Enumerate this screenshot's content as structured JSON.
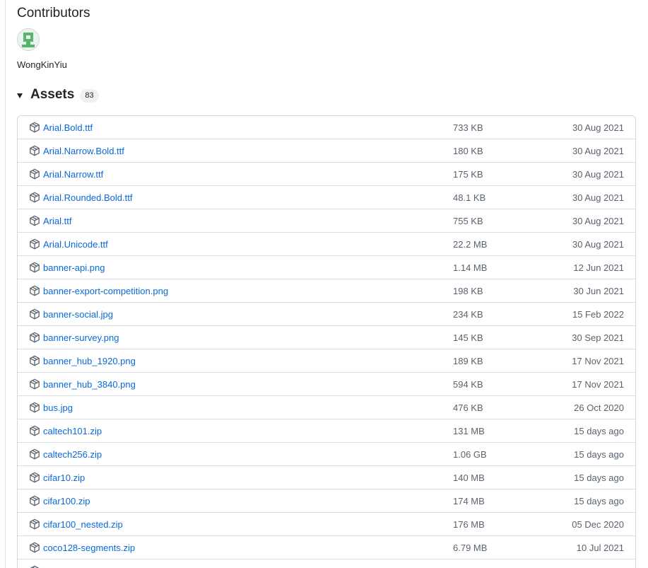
{
  "contributors": {
    "heading": "Contributors",
    "people": [
      {
        "name": "WongKinYiu"
      }
    ]
  },
  "assets": {
    "title": "Assets",
    "count": "83",
    "items": [
      {
        "name": "Arial.Bold.ttf",
        "size": "733 KB",
        "date": "30 Aug 2021"
      },
      {
        "name": "Arial.Narrow.Bold.ttf",
        "size": "180 KB",
        "date": "30 Aug 2021"
      },
      {
        "name": "Arial.Narrow.ttf",
        "size": "175 KB",
        "date": "30 Aug 2021"
      },
      {
        "name": "Arial.Rounded.Bold.ttf",
        "size": "48.1 KB",
        "date": "30 Aug 2021"
      },
      {
        "name": "Arial.ttf",
        "size": "755 KB",
        "date": "30 Aug 2021"
      },
      {
        "name": "Arial.Unicode.ttf",
        "size": "22.2 MB",
        "date": "30 Aug 2021"
      },
      {
        "name": "banner-api.png",
        "size": "1.14 MB",
        "date": "12 Jun 2021"
      },
      {
        "name": "banner-export-competition.png",
        "size": "198 KB",
        "date": "30 Jun 2021"
      },
      {
        "name": "banner-social.jpg",
        "size": "234 KB",
        "date": "15 Feb 2022"
      },
      {
        "name": "banner-survey.png",
        "size": "145 KB",
        "date": "30 Sep 2021"
      },
      {
        "name": "banner_hub_1920.png",
        "size": "189 KB",
        "date": "17 Nov 2021"
      },
      {
        "name": "banner_hub_3840.png",
        "size": "594 KB",
        "date": "17 Nov 2021"
      },
      {
        "name": "bus.jpg",
        "size": "476 KB",
        "date": "26 Oct 2020"
      },
      {
        "name": "caltech101.zip",
        "size": "131 MB",
        "date": "15 days ago"
      },
      {
        "name": "caltech256.zip",
        "size": "1.06 GB",
        "date": "15 days ago"
      },
      {
        "name": "cifar10.zip",
        "size": "140 MB",
        "date": "15 days ago"
      },
      {
        "name": "cifar100.zip",
        "size": "174 MB",
        "date": "15 days ago"
      },
      {
        "name": "cifar100_nested.zip",
        "size": "176 MB",
        "date": "05 Dec 2020"
      },
      {
        "name": "coco128-segments.zip",
        "size": "6.79 MB",
        "date": "10 Jul 2021"
      },
      {
        "name": "",
        "size": "",
        "date": ""
      }
    ]
  },
  "icons": {
    "asset": "package-icon",
    "caret": "triangle-down-icon"
  },
  "colors": {
    "link": "#0969da",
    "muted": "#59636e",
    "border": "#d0d7de"
  }
}
